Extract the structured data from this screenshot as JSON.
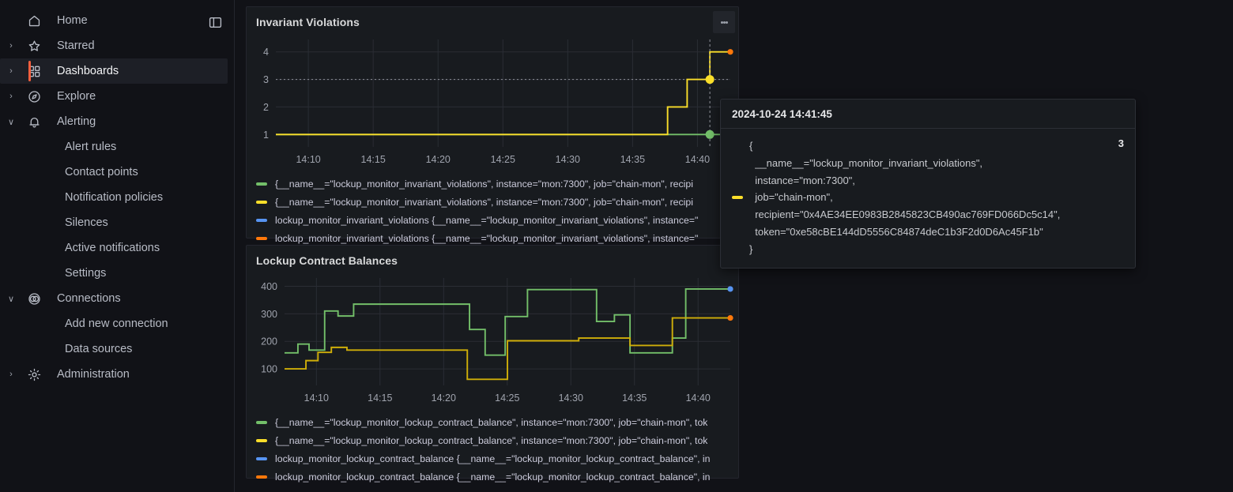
{
  "sidebar": {
    "dock_icon": "dock-menu-icon",
    "items": [
      {
        "label": "Home",
        "icon": "home-icon",
        "chevron": "",
        "level": 0,
        "active": false
      },
      {
        "label": "Starred",
        "icon": "star-icon",
        "chevron": "›",
        "level": 0,
        "active": false
      },
      {
        "label": "Dashboards",
        "icon": "grid-icon",
        "chevron": "›",
        "level": 0,
        "active": true
      },
      {
        "label": "Explore",
        "icon": "compass-icon",
        "chevron": "›",
        "level": 0,
        "active": false
      },
      {
        "label": "Alerting",
        "icon": "bell-icon",
        "chevron": "∨",
        "level": 0,
        "active": false
      },
      {
        "label": "Alert rules",
        "icon": "",
        "chevron": "",
        "level": 1,
        "active": false
      },
      {
        "label": "Contact points",
        "icon": "",
        "chevron": "",
        "level": 1,
        "active": false
      },
      {
        "label": "Notification policies",
        "icon": "",
        "chevron": "",
        "level": 1,
        "active": false
      },
      {
        "label": "Silences",
        "icon": "",
        "chevron": "",
        "level": 1,
        "active": false
      },
      {
        "label": "Active notifications",
        "icon": "",
        "chevron": "",
        "level": 1,
        "active": false
      },
      {
        "label": "Settings",
        "icon": "",
        "chevron": "",
        "level": 1,
        "active": false
      },
      {
        "label": "Connections",
        "icon": "connections-icon",
        "chevron": "∨",
        "level": 0,
        "active": false
      },
      {
        "label": "Add new connection",
        "icon": "",
        "chevron": "",
        "level": 1,
        "active": false
      },
      {
        "label": "Data sources",
        "icon": "",
        "chevron": "",
        "level": 1,
        "active": false
      },
      {
        "label": "Administration",
        "icon": "gear-icon",
        "chevron": "›",
        "level": 0,
        "active": false
      }
    ]
  },
  "colors": {
    "green": "#73bf69",
    "yellow": "#fade2a",
    "blue": "#5794f2",
    "orange": "#ff780a",
    "dark_yellow": "#cfae09",
    "accent": "#f55f3e",
    "panel_bg": "#181b1f",
    "page_bg": "#111217",
    "grid": "#2a2d34",
    "axis_text": "#9fa3ad"
  },
  "panels": [
    {
      "title": "Invariant Violations",
      "menu_icon": "kebab-menu-icon",
      "legend": [
        {
          "color": "#73bf69",
          "text": "{__name__=\"lockup_monitor_invariant_violations\", instance=\"mon:7300\", job=\"chain-mon\", recipi"
        },
        {
          "color": "#fade2a",
          "text": "{__name__=\"lockup_monitor_invariant_violations\", instance=\"mon:7300\", job=\"chain-mon\", recipi"
        },
        {
          "color": "#5794f2",
          "text": "lockup_monitor_invariant_violations {__name__=\"lockup_monitor_invariant_violations\", instance=\""
        },
        {
          "color": "#ff780a",
          "text": "lockup_monitor_invariant_violations {__name__=\"lockup_monitor_invariant_violations\", instance=\""
        }
      ]
    },
    {
      "title": "Lockup Contract Balances",
      "legend": [
        {
          "color": "#73bf69",
          "text": "{__name__=\"lockup_monitor_lockup_contract_balance\", instance=\"mon:7300\", job=\"chain-mon\", tok"
        },
        {
          "color": "#fade2a",
          "text": "{__name__=\"lockup_monitor_lockup_contract_balance\", instance=\"mon:7300\", job=\"chain-mon\", tok"
        },
        {
          "color": "#5794f2",
          "text": "lockup_monitor_lockup_contract_balance {__name__=\"lockup_monitor_lockup_contract_balance\", in"
        },
        {
          "color": "#ff780a",
          "text": "lockup_monitor_lockup_contract_balance {__name__=\"lockup_monitor_lockup_contract_balance\", in"
        }
      ]
    }
  ],
  "tooltip": {
    "timestamp": "2024-10-24 14:41:45",
    "series_color": "#fade2a",
    "value": "3",
    "json_text": "{\n  __name__=\"lockup_monitor_invariant_violations\",\n  instance=\"mon:7300\",\n  job=\"chain-mon\",\n  recipient=\"0x4AE34EE0983B2845823CB490ac769FD066Dc5c14\",\n  token=\"0xe58cBE144dD5556C84874deC1b3F2d0D6Ac45F1b\"\n}"
  },
  "chart_data": [
    {
      "type": "line",
      "title": "Invariant Violations",
      "xlabel": "",
      "ylabel": "",
      "ylim": [
        0.55,
        4.45
      ],
      "yticks": [
        1,
        2,
        3,
        4
      ],
      "xticks": [
        "14:10",
        "14:15",
        "14:20",
        "14:25",
        "14:30",
        "14:35",
        "14:40"
      ],
      "grid": true,
      "legend_position": "bottom",
      "threshold_line": 3,
      "crosshair_x": "14:41:45",
      "series": [
        {
          "name": "green-series",
          "color": "#73bf69",
          "step": true,
          "points": [
            [
              0.0,
              1
            ],
            [
              1.0,
              1
            ]
          ],
          "end_value": 1
        },
        {
          "name": "yellow-series",
          "color": "#fade2a",
          "step": true,
          "points": [
            [
              0.0,
              1
            ],
            [
              0.862,
              1
            ],
            [
              0.862,
              2
            ],
            [
              0.905,
              2
            ],
            [
              0.905,
              3
            ],
            [
              0.955,
              3
            ],
            [
              0.955,
              4
            ],
            [
              1.0,
              4
            ]
          ],
          "end_value": 4,
          "hover_value": 3
        }
      ]
    },
    {
      "type": "line",
      "title": "Lockup Contract Balances",
      "xlabel": "",
      "ylabel": "",
      "ylim": [
        40,
        430
      ],
      "yticks": [
        100,
        200,
        300,
        400
      ],
      "xticks": [
        "14:10",
        "14:15",
        "14:20",
        "14:25",
        "14:30",
        "14:35",
        "14:40"
      ],
      "grid": true,
      "legend_position": "bottom",
      "series": [
        {
          "name": "green-series",
          "color": "#73bf69",
          "step": true,
          "end_value": 390,
          "points": [
            [
              0.0,
              158
            ],
            [
              0.03,
              158
            ],
            [
              0.03,
              190
            ],
            [
              0.055,
              190
            ],
            [
              0.055,
              168
            ],
            [
              0.09,
              168
            ],
            [
              0.09,
              310
            ],
            [
              0.12,
              310
            ],
            [
              0.12,
              292
            ],
            [
              0.155,
              292
            ],
            [
              0.155,
              335
            ],
            [
              0.415,
              335
            ],
            [
              0.415,
              243
            ],
            [
              0.45,
              243
            ],
            [
              0.45,
              150
            ],
            [
              0.495,
              150
            ],
            [
              0.495,
              290
            ],
            [
              0.545,
              290
            ],
            [
              0.545,
              388
            ],
            [
              0.7,
              388
            ],
            [
              0.7,
              272
            ],
            [
              0.74,
              272
            ],
            [
              0.74,
              296
            ],
            [
              0.775,
              296
            ],
            [
              0.775,
              158
            ],
            [
              0.87,
              158
            ],
            [
              0.87,
              212
            ],
            [
              0.9,
              212
            ],
            [
              0.9,
              390
            ],
            [
              1.0,
              390
            ]
          ]
        },
        {
          "name": "yellow-series",
          "color": "#cfae09",
          "step": true,
          "end_value": 285,
          "points": [
            [
              0.0,
              100
            ],
            [
              0.048,
              100
            ],
            [
              0.048,
              130
            ],
            [
              0.075,
              130
            ],
            [
              0.075,
              160
            ],
            [
              0.105,
              160
            ],
            [
              0.105,
              178
            ],
            [
              0.14,
              178
            ],
            [
              0.14,
              168
            ],
            [
              0.41,
              168
            ],
            [
              0.41,
              62
            ],
            [
              0.5,
              62
            ],
            [
              0.5,
              202
            ],
            [
              0.66,
              202
            ],
            [
              0.66,
              212
            ],
            [
              0.775,
              212
            ],
            [
              0.775,
              185
            ],
            [
              0.87,
              185
            ],
            [
              0.87,
              285
            ],
            [
              1.0,
              285
            ]
          ]
        }
      ]
    }
  ]
}
